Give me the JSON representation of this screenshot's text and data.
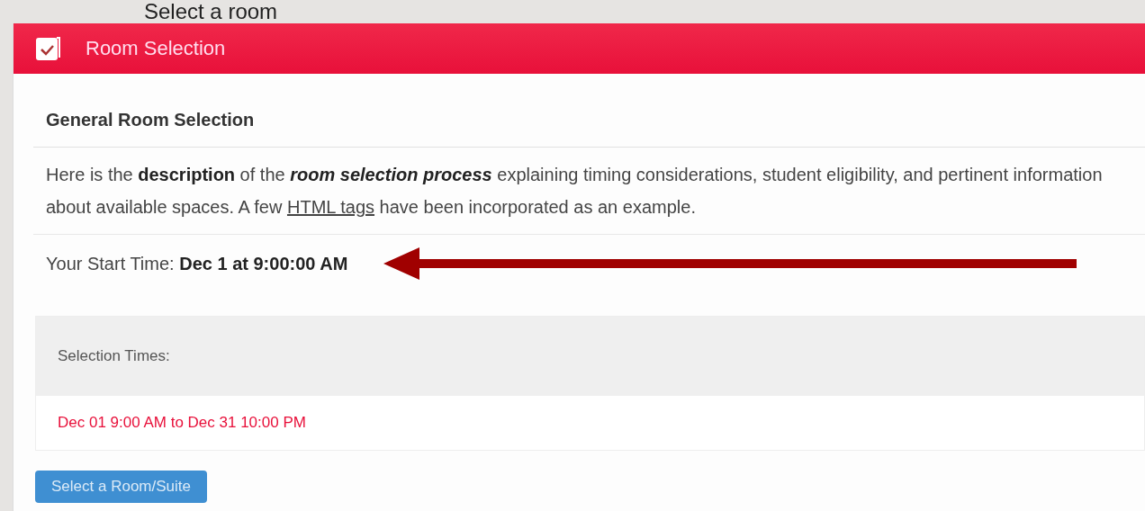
{
  "page_title": "Select a room",
  "panel": {
    "title": "Room Selection",
    "section_title": "General Room Selection",
    "description": [
      {
        "kind": "plain",
        "text": "Here is the "
      },
      {
        "kind": "bold",
        "text": "description"
      },
      {
        "kind": "plain",
        "text": " of the "
      },
      {
        "kind": "bolditalic",
        "text": "room selection process"
      },
      {
        "kind": "plain",
        "text": " explaining timing considerations, student eligibility, and pertinent information about available spaces. A few "
      },
      {
        "kind": "underline",
        "text": "HTML tags"
      },
      {
        "kind": "plain",
        "text": " have been incorporated as an example."
      }
    ],
    "start_time": "Your Start Time: **Dec 1 at 9:00:00 AM**",
    "selection_times": {
      "heading": "Selection Times:",
      "ranges": [
        "Dec 01 9:00 AM to Dec 31 10:00 PM"
      ]
    },
    "button": "Select a Room/Suite"
  }
}
